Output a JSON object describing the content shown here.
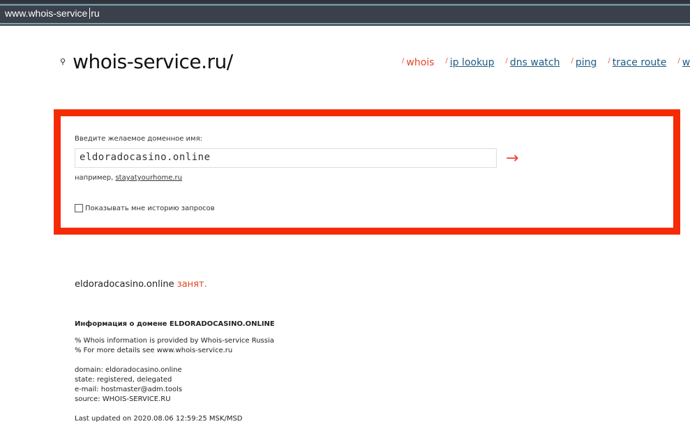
{
  "address_bar": {
    "text_before_caret": "www.whois-service",
    "text_after_caret": "ru"
  },
  "logo": {
    "icon": "search-icon",
    "text": "whois-service.ru/"
  },
  "nav": [
    {
      "label": "whois",
      "active": true
    },
    {
      "label": "ip lookup"
    },
    {
      "label": "dns watch"
    },
    {
      "label": "ping"
    },
    {
      "label": "trace route"
    },
    {
      "label": "wh"
    }
  ],
  "form": {
    "label": "Введите желаемое доменное имя:",
    "value": "eldoradocasino.online",
    "submit": "→",
    "example_prefix": "например,",
    "example_link": "stayatyourhome.ru",
    "checkbox_label": "Показывать мне историю запросов",
    "accent": "#f52b05"
  },
  "result": {
    "domain": "eldoradocasino.online",
    "status": "занят."
  },
  "info": {
    "heading": "Информация о домене ELDORADOCASINO.ONLINE",
    "notes": [
      "% Whois information is provided by Whois-service Russia",
      "% For more details see www.whois-service.ru"
    ],
    "fields": [
      "domain: eldoradocasino.online",
      "state: registered, delegated",
      "e-mail: hostmaster@adm.tools",
      "source: WHOIS-SERVICE.RU"
    ],
    "updated": "Last updated on 2020.08.06 12:59:25 MSK/MSD"
  }
}
